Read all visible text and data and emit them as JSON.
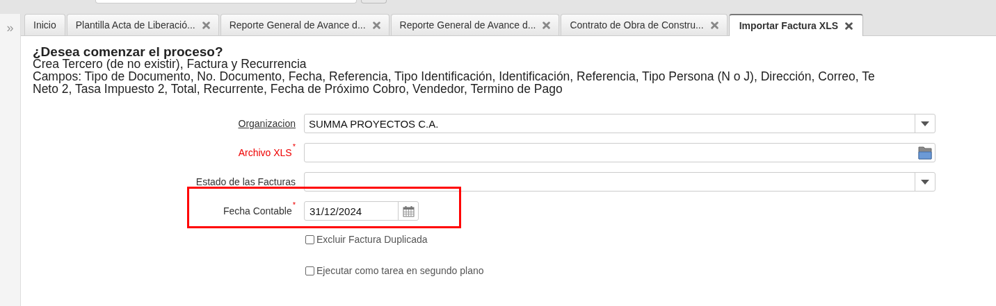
{
  "sidebar": {
    "toggle": "»"
  },
  "tabs": [
    {
      "label": "Inicio",
      "closable": false,
      "selected": false
    },
    {
      "label": "Plantilla Acta de Liberació...",
      "closable": true,
      "selected": false
    },
    {
      "label": "Reporte General de Avance d...",
      "closable": true,
      "selected": false
    },
    {
      "label": "Reporte General de Avance d...",
      "closable": true,
      "selected": false
    },
    {
      "label": "Contrato de Obra de Constru...",
      "closable": true,
      "selected": false
    },
    {
      "label": "Importar Factura XLS",
      "closable": true,
      "selected": true
    }
  ],
  "process": {
    "question": "¿Desea comenzar el proceso?",
    "description": [
      "Crea Tercero (de no existir), Factura y Recurrencia",
      "Campos: Tipo de Documento, No. Documento, Fecha, Referencia, Tipo Identificación, Identificación, Referencia, Tipo Persona (N o J), Dirección, Correo, Te",
      "Neto 2, Tasa Impuesto 2, Total, Recurrente, Fecha de Próximo Cobro, Vendedor, Termino de Pago"
    ]
  },
  "fields": [
    {
      "kind": "select",
      "label": "Organizacion",
      "link": true,
      "invalid": false,
      "value": "SUMMA PROYECTOS C.A.",
      "highlighted": false
    },
    {
      "kind": "file",
      "label": "Archivo XLS",
      "required_mark": "*",
      "link": false,
      "invalid": true,
      "highlighted": false
    },
    {
      "kind": "select",
      "label": "Estado de las Facturas",
      "link": false,
      "invalid": false,
      "highlighted": false
    },
    {
      "kind": "date",
      "label": "Fecha Contable",
      "required_mark": "*",
      "link": false,
      "invalid": false,
      "value": "31/12/2024",
      "highlighted": true
    }
  ],
  "options": [
    {
      "label": "Excluir Factura Duplicada",
      "checked": false
    },
    {
      "label": "Ejecutar como tarea en segundo plano",
      "checked": false
    }
  ]
}
